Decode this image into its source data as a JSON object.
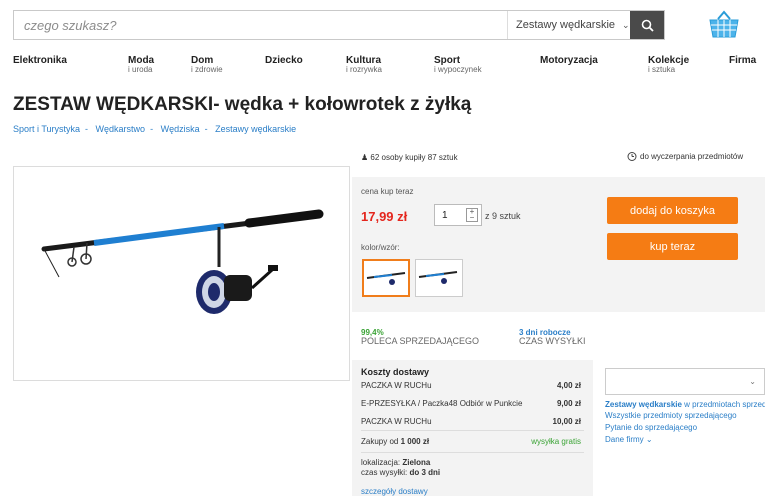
{
  "search": {
    "placeholder": "czego szukasz?",
    "category": "Zestawy wędkarskie"
  },
  "nav": [
    {
      "label": "Elektronika",
      "sub": ""
    },
    {
      "label": "Moda",
      "sub": "i uroda"
    },
    {
      "label": "Dom",
      "sub": "i zdrowie"
    },
    {
      "label": "Dziecko",
      "sub": ""
    },
    {
      "label": "Kultura",
      "sub": "i rozrywka"
    },
    {
      "label": "Sport",
      "sub": "i wypoczynek"
    },
    {
      "label": "Motoryzacja",
      "sub": ""
    },
    {
      "label": "Kolekcje",
      "sub": "i sztuka"
    },
    {
      "label": "Firma",
      "sub": ""
    }
  ],
  "product": {
    "title": "ZESTAW WĘDKARSKI- wędka + kołowrotek z żyłką",
    "breadcrumbs": [
      "Sport i Turystyka",
      "Wędkarstwo",
      "Wędziska",
      "Zestawy wędkarskie"
    ],
    "buyers": "62 osoby kupiły 87 sztuk",
    "timer": "do wyczerpania przedmiotów",
    "price_label": "cena kup teraz",
    "price": "17,99 zł",
    "quantity": "1",
    "quantity_of": "z 9 sztuk",
    "variant_label": "kolor/wzór:",
    "add_to_cart": "dodaj do koszyka",
    "buy_now": "kup teraz"
  },
  "stats": {
    "recommend_value": "99,4%",
    "recommend_label": "POLECA SPRZEDAJĄCEGO",
    "shipping_time_value": "3 dni robocze",
    "shipping_time_label": "CZAS WYSYŁKI"
  },
  "shipping": {
    "title": "Koszty dostawy",
    "rows": [
      {
        "name": "PACZKA W RUCHu",
        "price": "4,00 zł"
      },
      {
        "name": "E-PRZESYŁKA / Paczka48 Odbiór w Punkcie",
        "price": "9,00 zł"
      },
      {
        "name": "PACZKA W RUCHu",
        "price": "10,00 zł"
      }
    ],
    "free_from_label": "Zakupy od",
    "free_from_value": "1 000 zł",
    "free_label": "wysyłka gratis",
    "location_label": "lokalizacja:",
    "location_value": "Zielona",
    "send_time_label": "czas wysyłki:",
    "send_time_value": "do 3 dni",
    "details_link": "szczegóły dostawy"
  },
  "side": {
    "link1_strong": "Zestawy wędkarskie",
    "link1_rest": " w przedmiotach sprzedającego",
    "link2": "Wszystkie przedmioty sprzedającego",
    "link3": "Pytanie do sprzedającego",
    "link4": "Dane firmy"
  },
  "colors": {
    "accent_orange": "#f57c14",
    "price_red": "#e4261d",
    "link_blue": "#2a7ec7",
    "green": "#3aa335"
  }
}
